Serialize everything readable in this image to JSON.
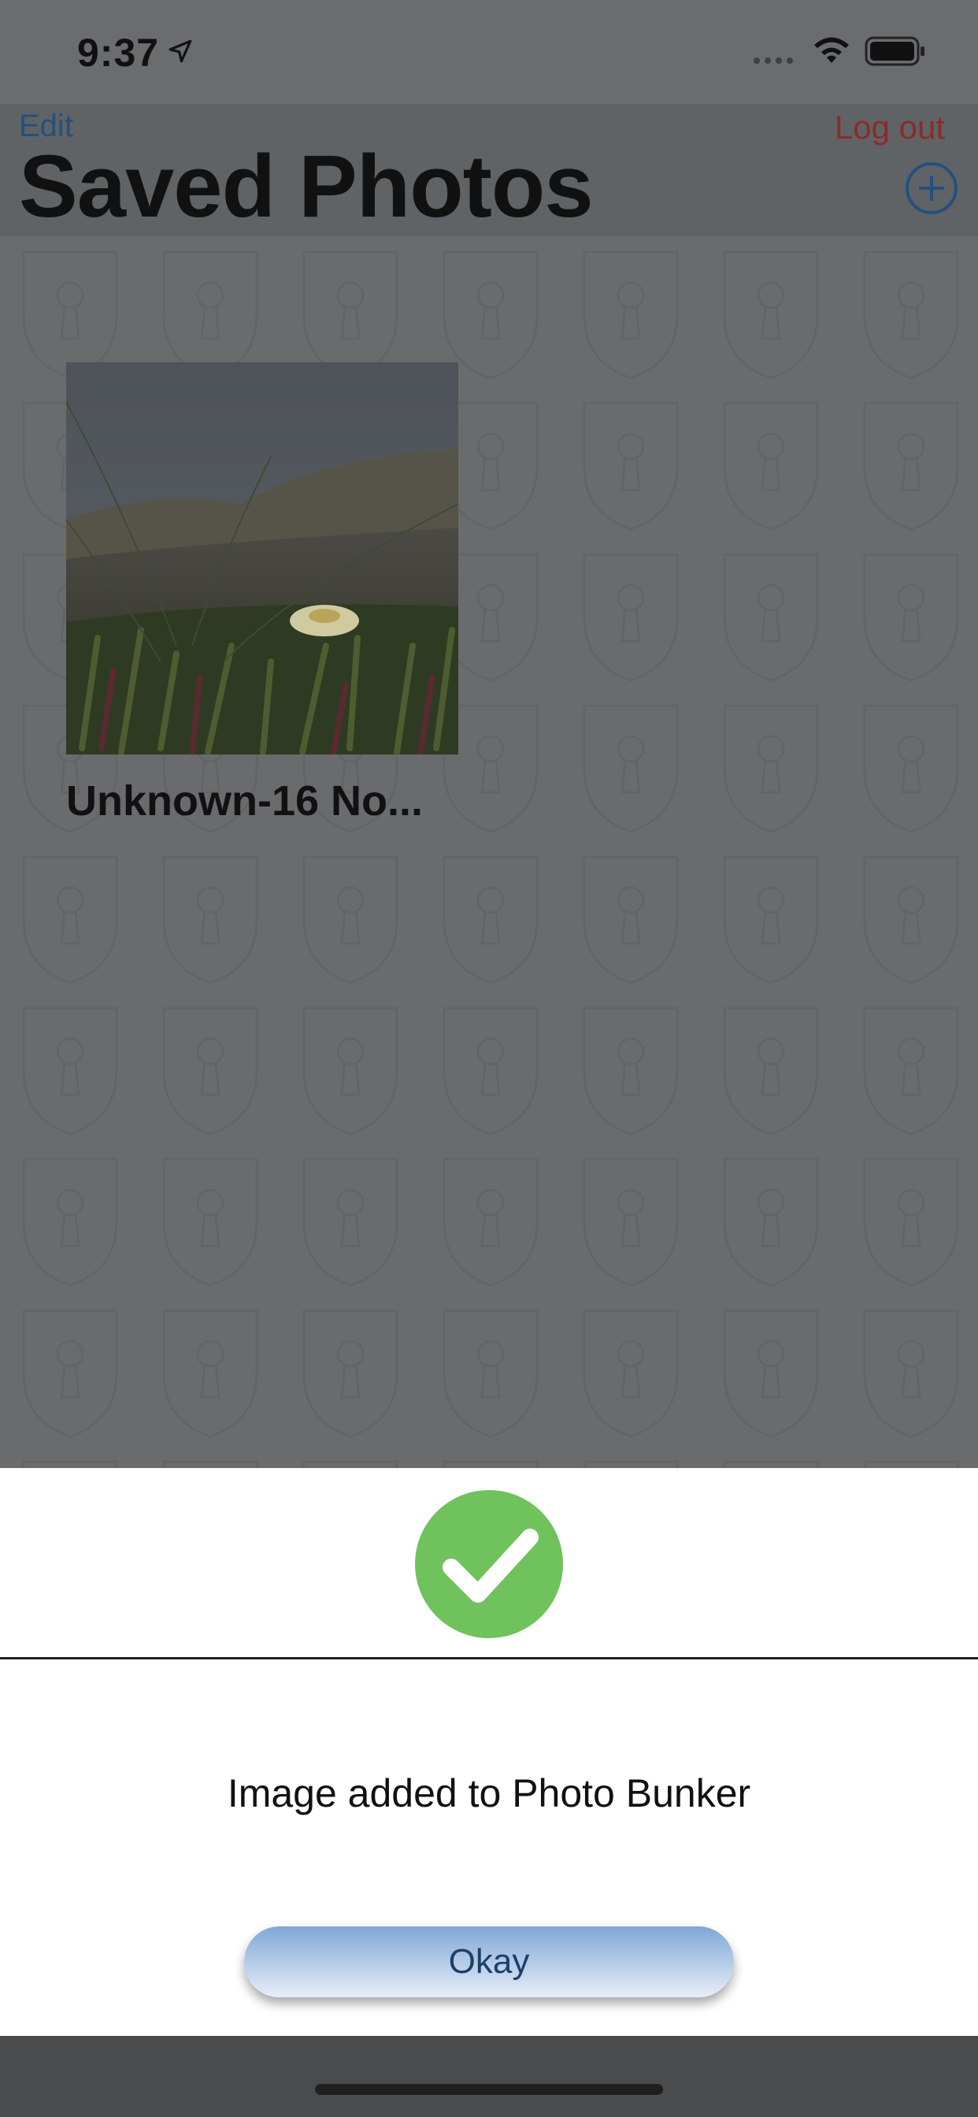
{
  "status": {
    "time": "9:37"
  },
  "nav": {
    "edit_label": "Edit",
    "logout_label": "Log out",
    "title": "Saved Photos"
  },
  "photos": [
    {
      "caption": "Unknown-16 No..."
    }
  ],
  "alert": {
    "message": "Image added to Photo Bunker",
    "okay_label": "Okay"
  },
  "colors": {
    "edit": "#24507c",
    "logout": "#8b2b2b",
    "success_green": "#6fc25c",
    "button_blue": "#7fa7d7"
  },
  "icons": [
    "location-arrow-icon",
    "signal-icon",
    "wifi-icon",
    "battery-icon",
    "add-circle-icon",
    "checkmark-icon"
  ]
}
